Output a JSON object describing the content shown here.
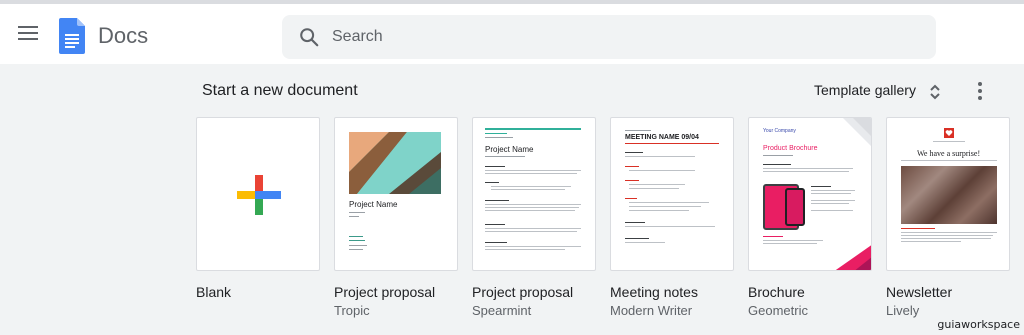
{
  "header": {
    "app_title": "Docs",
    "icons": {
      "menu": "hamburger-menu-icon",
      "logo": "docs-logo-icon",
      "search": "search-icon"
    }
  },
  "search": {
    "placeholder": "Search"
  },
  "gallery": {
    "title": "Start a new document",
    "template_gallery_label": "Template gallery",
    "templates": [
      {
        "name": "Blank",
        "subtitle": ""
      },
      {
        "name": "Project proposal",
        "subtitle": "Tropic",
        "thumb_title": "Project Name"
      },
      {
        "name": "Project proposal",
        "subtitle": "Spearmint",
        "thumb_title": "Project Name"
      },
      {
        "name": "Meeting notes",
        "subtitle": "Modern Writer",
        "thumb_title": "MEETING NAME 09/04"
      },
      {
        "name": "Brochure",
        "subtitle": "Geometric",
        "thumb_title": "Product Brochure",
        "thumb_top": "Your Company"
      },
      {
        "name": "Newsletter",
        "subtitle": "Lively",
        "thumb_title": "We have a surprise!"
      }
    ]
  },
  "colors": {
    "docs_blue": "#4285f4",
    "plus_red": "#ea4335",
    "plus_yellow": "#fbbc04",
    "plus_green": "#34a853",
    "plus_blue": "#4285f4",
    "accent_pink": "#e91e63"
  },
  "watermark": "guiaworkspace"
}
